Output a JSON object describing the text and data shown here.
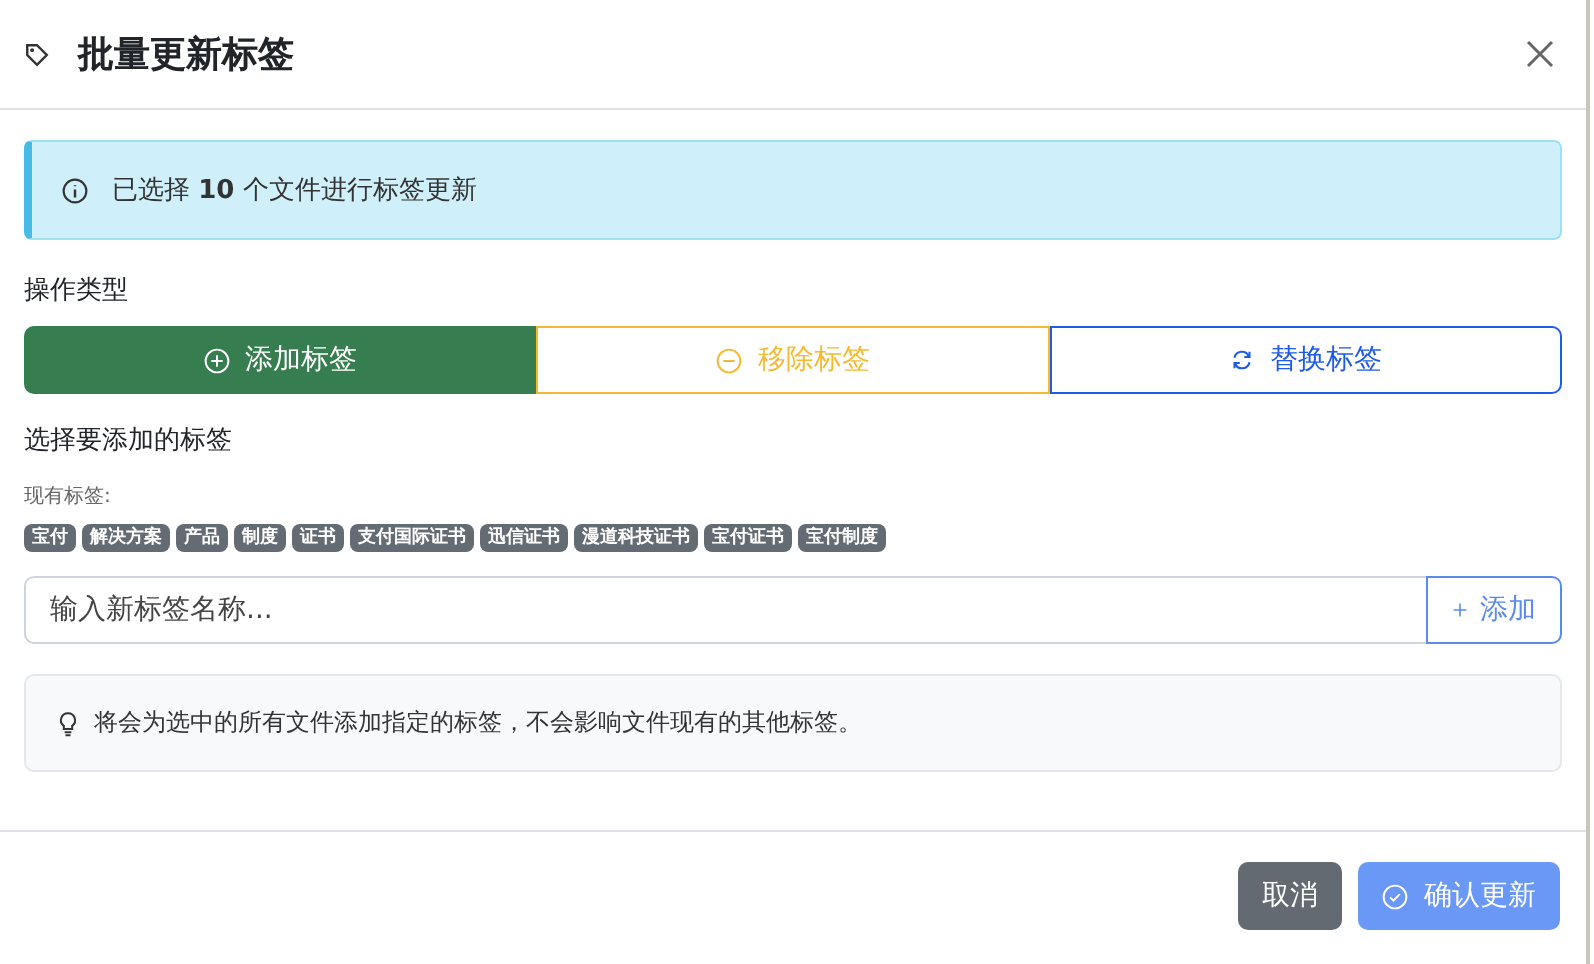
{
  "dialog": {
    "title": "批量更新标签"
  },
  "alert": {
    "text": "已选择 **10** 个文件进行标签更新"
  },
  "operation": {
    "label": "操作类型",
    "options": [
      {
        "kind": "add",
        "label": "添加标签",
        "selected": true
      },
      {
        "kind": "remove",
        "label": "移除标签",
        "selected": false
      },
      {
        "kind": "replace",
        "label": "替换标签",
        "selected": false
      }
    ]
  },
  "section_title": "选择要添加的标签",
  "existing": {
    "label": "现有标签:",
    "tags": [
      "宝付",
      "解决方案",
      "产品",
      "制度",
      "证书",
      "支付国际证书",
      "迅信证书",
      "漫道科技证书",
      "宝付证书",
      "宝付制度"
    ]
  },
  "new_tag": {
    "placeholder": "输入新标签名称...",
    "button": "添加"
  },
  "hint": "将会为选中的所有文件添加指定的标签，不会影响文件现有的其他标签。",
  "footer": {
    "cancel": "取消",
    "confirm": "确认更新",
    "confirm_disabled": true
  }
}
